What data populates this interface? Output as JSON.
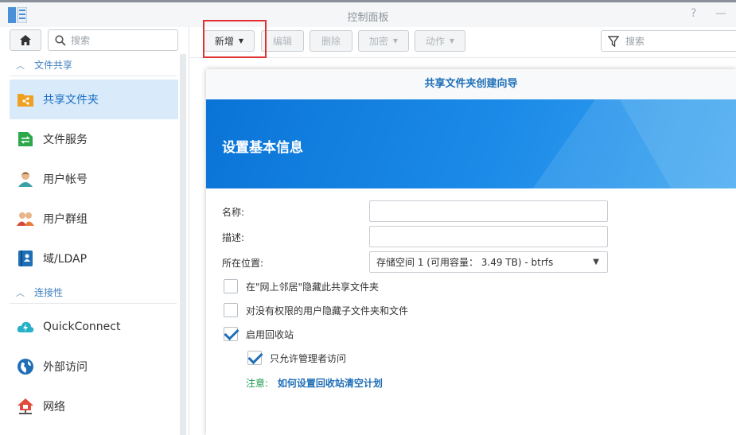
{
  "window": {
    "title": "控制面板",
    "help_glyph": "?",
    "minimize_glyph": "—"
  },
  "sidebar": {
    "search_placeholder": "搜索",
    "sections": [
      {
        "label": "文件共享"
      },
      {
        "label": "连接性"
      }
    ],
    "items": [
      {
        "label": "共享文件夹",
        "icon": "shared-folder-icon",
        "active": true
      },
      {
        "label": "文件服务",
        "icon": "file-services-icon"
      },
      {
        "label": "用户帐号",
        "icon": "user-icon"
      },
      {
        "label": "用户群组",
        "icon": "group-icon"
      },
      {
        "label": "域/LDAP",
        "icon": "domain-ldap-icon"
      },
      {
        "label": "QuickConnect",
        "icon": "quickconnect-icon"
      },
      {
        "label": "外部访问",
        "icon": "external-access-icon"
      },
      {
        "label": "网络",
        "icon": "network-icon"
      }
    ]
  },
  "toolbar": {
    "create_label": "新增",
    "edit_label": "编辑",
    "delete_label": "删除",
    "encrypt_label": "加密",
    "action_label": "动作",
    "search_placeholder": "搜索"
  },
  "wizard": {
    "title": "共享文件夹创建向导",
    "heading": "设置基本信息",
    "name_label": "名称:",
    "desc_label": "描述:",
    "location_label": "所在位置:",
    "location_value": "存储空间 1 (可用容量： 3.49 TB) - btrfs",
    "hide_network_label": "在\"网上邻居\"隐藏此共享文件夹",
    "hide_subfolders_label": "对没有权限的用户隐藏子文件夹和文件",
    "recycle_bin_label": "启用回收站",
    "admin_only_label": "只允许管理者访问",
    "note_label": "注意:",
    "note_link": "如何设置回收站清空计划",
    "checkbox_states": {
      "hide_network": false,
      "hide_subfolders": false,
      "recycle_bin": true,
      "admin_only": true
    }
  },
  "colors": {
    "accent": "#1f6fb7",
    "banner": "#0a74d6",
    "highlight_box": "#e03131",
    "note_green": "#1b9d4c"
  }
}
